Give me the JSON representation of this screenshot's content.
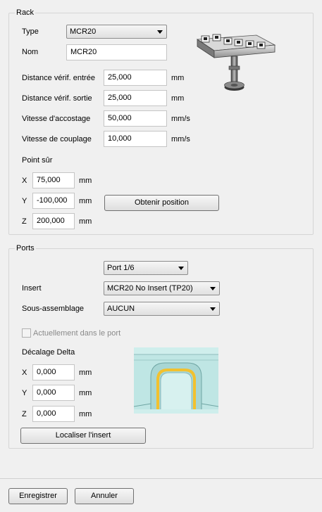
{
  "rack": {
    "title": "Rack",
    "type_label": "Type",
    "type_value": "MCR20",
    "name_label": "Nom",
    "name_value": "MCR20",
    "entry_dist_label": "Distance vérif. entrée",
    "entry_dist_value": "25,000",
    "entry_dist_unit": "mm",
    "exit_dist_label": "Distance vérif. sortie",
    "exit_dist_value": "25,000",
    "exit_dist_unit": "mm",
    "dock_speed_label": "Vitesse d'accostage",
    "dock_speed_value": "50,000",
    "dock_speed_unit": "mm/s",
    "couple_speed_label": "Vitesse de couplage",
    "couple_speed_value": "10,000",
    "couple_speed_unit": "mm/s",
    "safe_point_label": "Point sûr",
    "x_label": "X",
    "x_value": "75,000",
    "x_unit": "mm",
    "y_label": "Y",
    "y_value": "-100,000",
    "y_unit": "mm",
    "z_label": "Z",
    "z_value": "200,000",
    "z_unit": "mm",
    "get_position_button": "Obtenir position",
    "image_icon": "rack-image-icon"
  },
  "ports": {
    "title": "Ports",
    "port_value": "Port 1/6",
    "insert_label": "Insert",
    "insert_value": "MCR20 No Insert (TP20)",
    "subassembly_label": "Sous-assemblage",
    "subassembly_value": "AUCUN",
    "in_port_label": "Actuellement dans le port",
    "delta_label": "Décalage Delta",
    "dx_label": "X",
    "dx_value": "0,000",
    "dx_unit": "mm",
    "dy_label": "Y",
    "dy_value": "0,000",
    "dy_unit": "mm",
    "dz_label": "Z",
    "dz_value": "0,000",
    "dz_unit": "mm",
    "locate_button": "Localiser l'insert",
    "image_icon": "insert-image-icon"
  },
  "footer": {
    "save_button": "Enregistrer",
    "cancel_button": "Annuler"
  },
  "colors": {
    "background": "#f0f0f0",
    "insert_teal": "#bfe6e4",
    "insert_yellow": "#f2c12e"
  }
}
